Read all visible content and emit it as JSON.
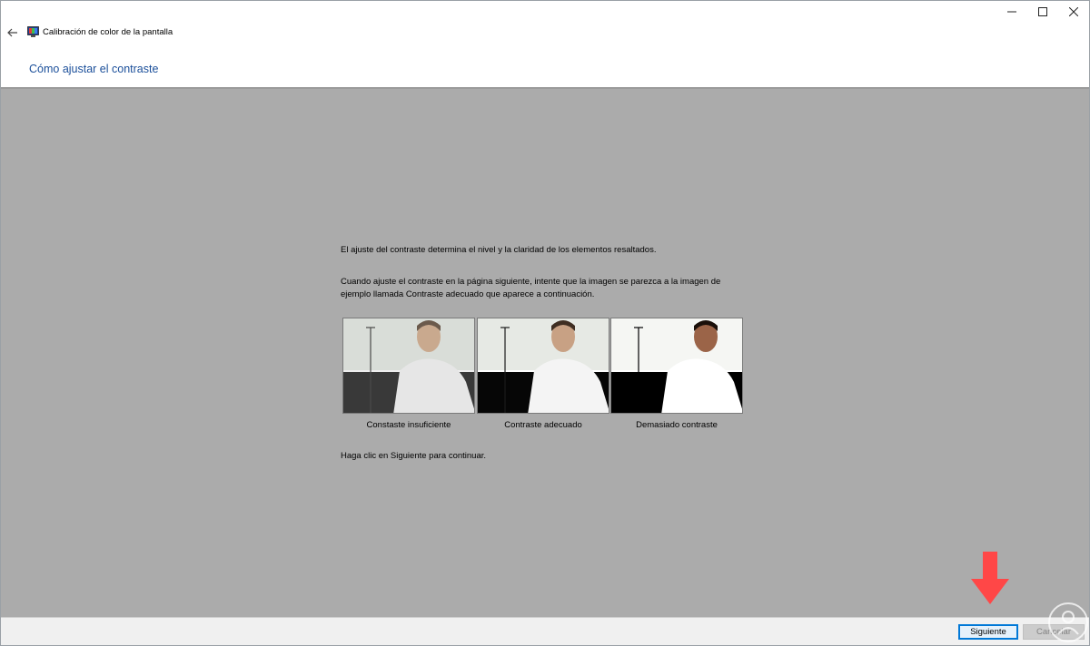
{
  "window": {
    "title": "Calibración de color de la pantalla",
    "controls": [
      "minimize",
      "maximize",
      "close"
    ]
  },
  "header": {
    "title": "Cómo ajustar el contraste"
  },
  "content": {
    "intro": "El ajuste del contraste determina el nivel y la claridad de los elementos resaltados.",
    "instruction": "Cuando ajuste el contraste en la página siguiente, intente que la imagen se parezca a la imagen de ejemplo llamada Contraste adecuado que aparece a continuación.",
    "samples": [
      {
        "caption": "Constaste insuficiente"
      },
      {
        "caption": "Contraste adecuado"
      },
      {
        "caption": "Demasiado contraste"
      }
    ],
    "continue_text": "Haga clic en Siguiente para continuar."
  },
  "footer": {
    "next_label": "Siguiente",
    "cancel_label": "Cancelar"
  },
  "colors": {
    "accent": "#0078d7",
    "title_blue": "#1b4f9a",
    "content_bg": "#ababab",
    "annotation_arrow": "#ff4747"
  },
  "icons": {
    "back": "back-arrow-icon",
    "app": "monitor-color-icon",
    "minimize": "minimize-icon",
    "maximize": "maximize-icon",
    "close": "close-icon"
  }
}
